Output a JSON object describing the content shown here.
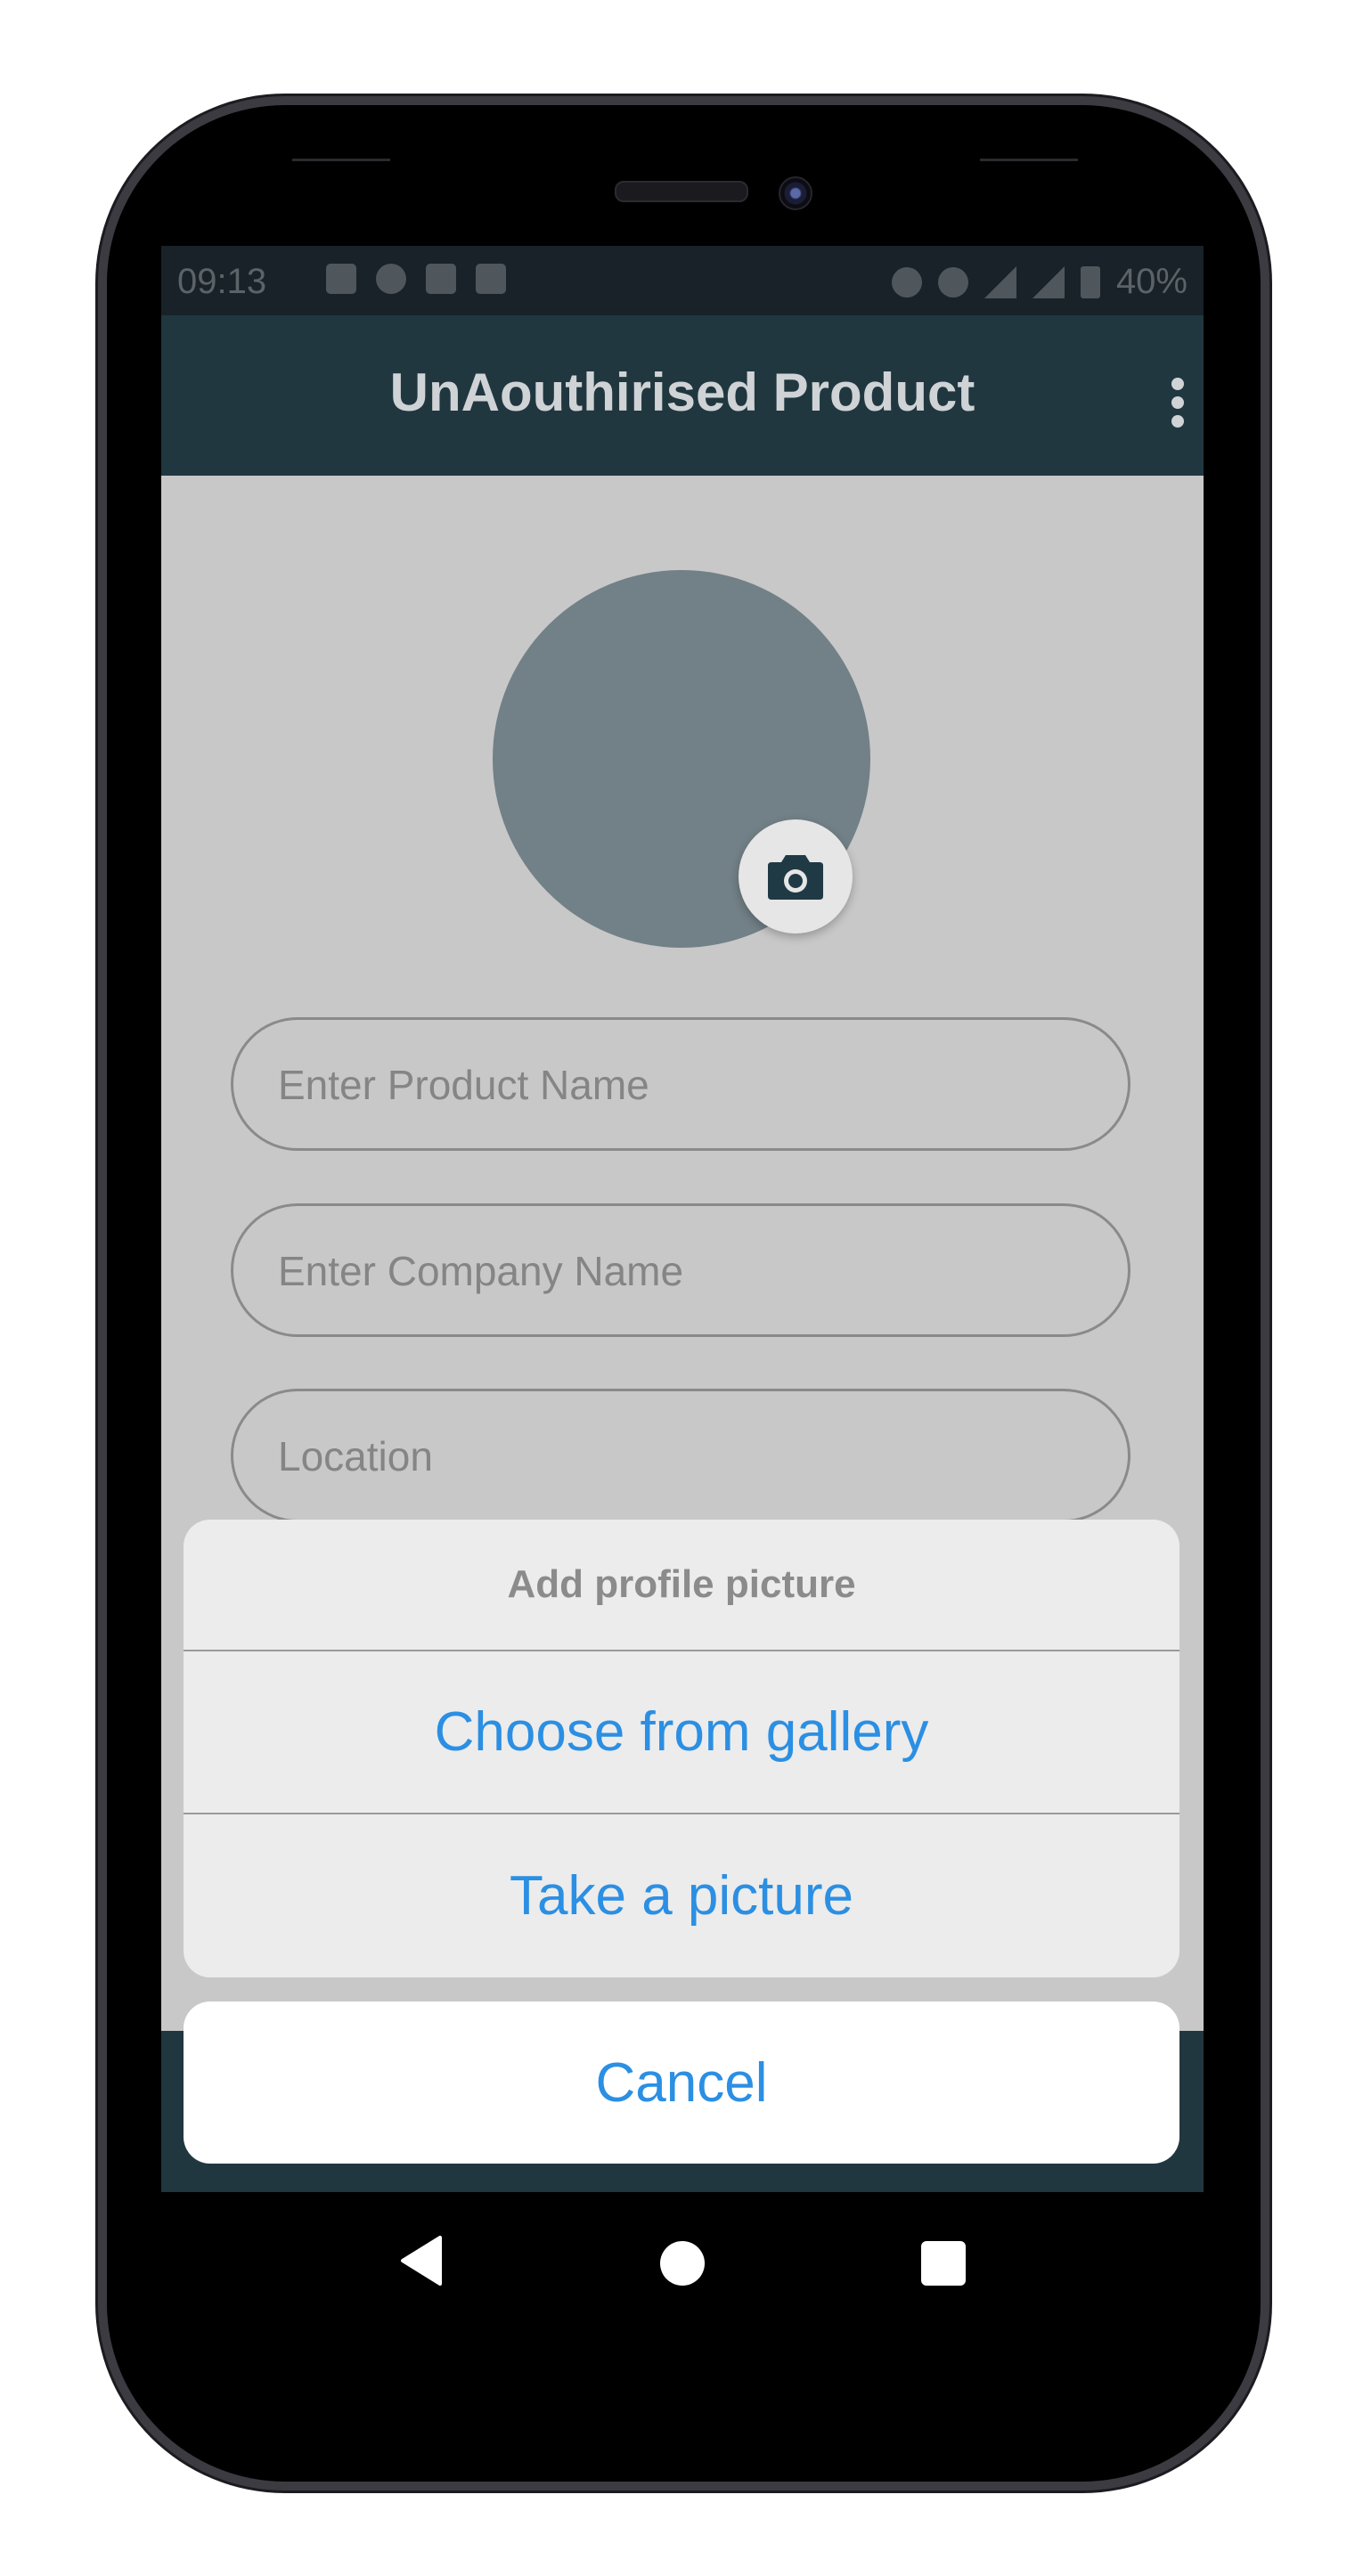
{
  "status_bar": {
    "time": "09:13",
    "battery": "40%",
    "left_icons": [
      "image-icon",
      "chat-bubble-icon",
      "gmail-icon",
      "lock-icon"
    ],
    "right_icons": [
      "bell-off-icon",
      "hotspot-icon",
      "signal-h-plus-icon",
      "signal-icon",
      "signal-icon",
      "battery-icon"
    ]
  },
  "app_bar": {
    "title": "UnAouthirised Product",
    "menu_icon": "more-vert-icon"
  },
  "form": {
    "avatar_icon": "camera-icon",
    "product_name_placeholder": "Enter Product Name",
    "company_name_placeholder": "Enter Company Name",
    "location_placeholder": "Location"
  },
  "action_sheet": {
    "title": "Add profile picture",
    "gallery_label": "Choose from gallery",
    "camera_label": "Take a picture",
    "cancel_label": "Cancel"
  },
  "nav_bar": {
    "icons": [
      "back-icon",
      "home-icon",
      "recents-icon"
    ]
  },
  "colors": {
    "app_bar": "#203740",
    "accent_blue": "#2b8fe3",
    "avatar": "#728087",
    "screen_dimmed": "#c8c8c8"
  }
}
